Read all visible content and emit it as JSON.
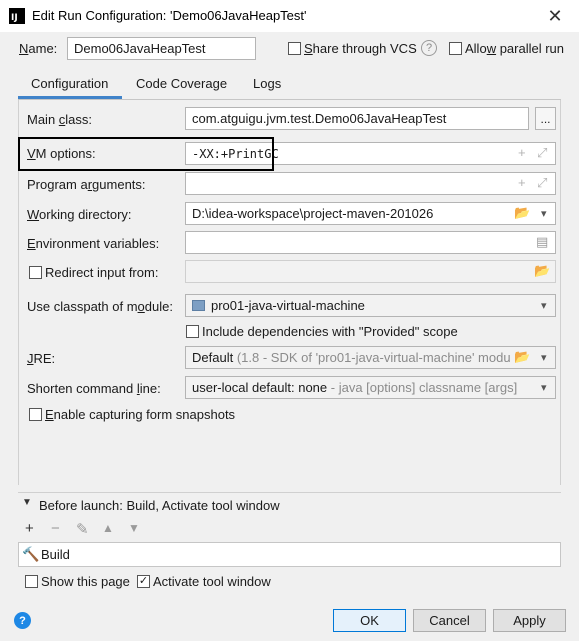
{
  "window": {
    "title": "Edit Run Configuration: 'Demo06JavaHeapTest'",
    "app_icon_text": "IJ"
  },
  "name": {
    "label": "Name:",
    "value": "Demo06JavaHeapTest"
  },
  "share_vcs": {
    "label": "Share through VCS",
    "checked": false
  },
  "allow_parallel": {
    "label": "Allow parallel run",
    "checked": false
  },
  "tabs": [
    {
      "label": "Configuration",
      "active": true
    },
    {
      "label": "Code Coverage",
      "active": false
    },
    {
      "label": "Logs",
      "active": false
    }
  ],
  "main_class": {
    "label": "Main class:",
    "value": "com.atguigu.jvm.test.Demo06JavaHeapTest",
    "browse_label": "..."
  },
  "vm_options": {
    "label": "VM options:",
    "value": "-XX:+PrintGC"
  },
  "program_arguments": {
    "label": "Program arguments:",
    "value": ""
  },
  "working_directory": {
    "label": "Working directory:",
    "value": "D:\\idea-workspace\\project-maven-201026"
  },
  "environment_variables": {
    "label": "Environment variables:",
    "value": ""
  },
  "redirect_input": {
    "label": "Redirect input from:",
    "checked": false,
    "value": ""
  },
  "classpath_module": {
    "label": "Use classpath of module:",
    "value": "pro01-java-virtual-machine"
  },
  "include_provided": {
    "label": "Include dependencies with \"Provided\" scope",
    "checked": false
  },
  "jre": {
    "label": "JRE:",
    "value": "Default",
    "hint": "(1.8 - SDK of 'pro01-java-virtual-machine' modu"
  },
  "shorten_command_line": {
    "label": "Shorten command line:",
    "value": "user-local default: none",
    "hint": "- java [options] classname [args]"
  },
  "capture_form_snapshots": {
    "label": "Enable capturing form snapshots",
    "checked": false
  },
  "before_launch": {
    "label": "Before launch: Build, Activate tool window",
    "items": [
      "Build"
    ]
  },
  "show_this_page": {
    "label": "Show this page",
    "checked": false
  },
  "activate_tool_window": {
    "label": "Activate tool window",
    "checked": true
  },
  "buttons": {
    "ok": "OK",
    "cancel": "Cancel",
    "apply": "Apply"
  },
  "help_icon": "?",
  "colors": {
    "accent": "#4083c9",
    "default_button_border": "#0078d7"
  }
}
